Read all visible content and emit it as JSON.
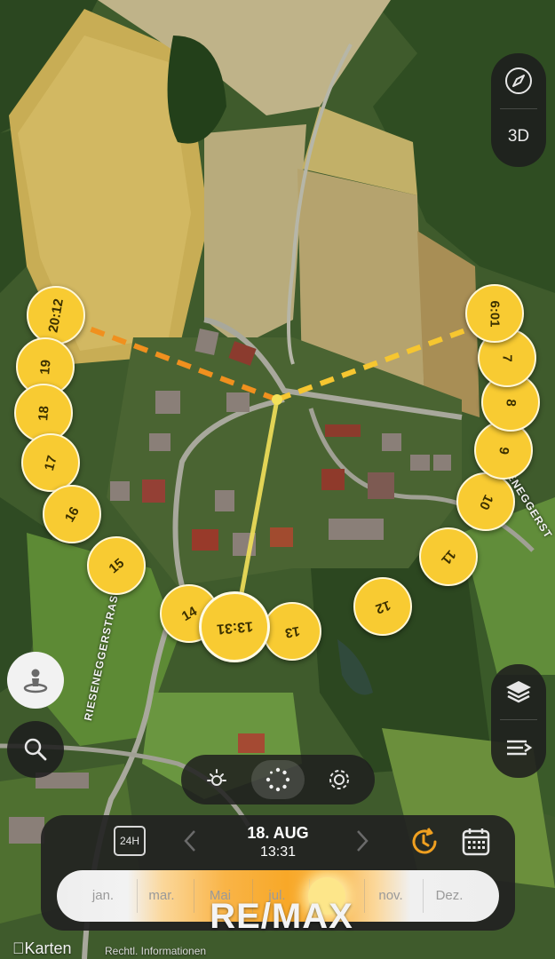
{
  "map": {
    "street_left": "RIESENEGGERSTRASSE",
    "street_right": "ENEGGERST",
    "attribution_app": "Karten",
    "attribution_legal": "Rechtl. Informationen",
    "watermark": "RE/MAX"
  },
  "sun_path": {
    "sunrise_label": "6:01",
    "sunset_label": "20:12",
    "current_label": "13:31",
    "hours": [
      "7",
      "8",
      "9",
      "10",
      "11",
      "12",
      "13",
      "14",
      "15",
      "16",
      "17",
      "18",
      "19"
    ],
    "colors": {
      "bubble": "#f8cb32",
      "sunrise_line": "#f6c630",
      "sunset_line": "#f0901e",
      "current_line": "#f3e15a"
    }
  },
  "controls": {
    "compass_icon": "compass-icon",
    "threed_label": "3D",
    "layers_icon": "layers-icon",
    "list_icon": "list-arrow-icon",
    "person_icon": "person-location-icon",
    "search_icon": "search-icon",
    "modes": [
      "sun-icon",
      "sun-path-dots-icon",
      "gear-icon"
    ],
    "active_mode": "sun-path-dots-icon"
  },
  "time_panel": {
    "toggle_24h": "24H",
    "date": "18. AUG",
    "time": "13:31",
    "clock_icon": "clock-reset-icon",
    "calendar_icon": "calendar-icon",
    "accent": "#f0a020",
    "months": [
      "jan.",
      "mar.",
      "Mai",
      "jul.",
      "",
      "nov.",
      "Dez."
    ],
    "selected_month_fraction": 0.62
  }
}
